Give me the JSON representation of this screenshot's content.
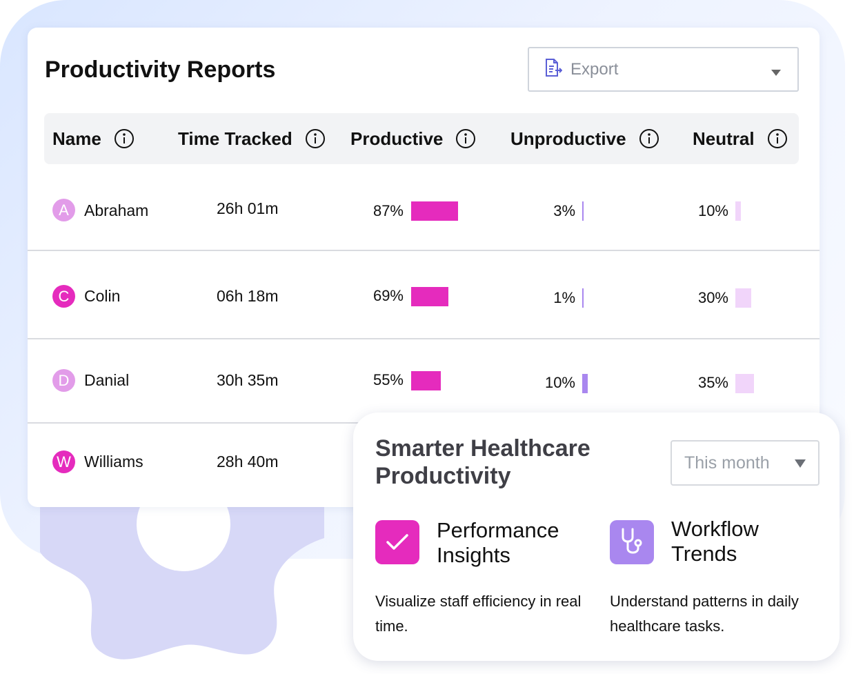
{
  "report": {
    "title": "Productivity Reports",
    "export_label": "Export",
    "columns": [
      {
        "label": "Name"
      },
      {
        "label": "Time Tracked"
      },
      {
        "label": "Productive"
      },
      {
        "label": "Unproductive"
      },
      {
        "label": "Neutral"
      }
    ],
    "rows": [
      {
        "initial": "A",
        "name": "Abraham",
        "time": "26h 01m",
        "productive": "87%",
        "productive_value": 0.87,
        "unproductive": "3%",
        "unproductive_value": 0.03,
        "neutral": "10%",
        "neutral_value": 0.1,
        "avatar_color": "#e29ce9"
      },
      {
        "initial": "C",
        "name": "Colin",
        "time": "06h 18m",
        "productive": "69%",
        "productive_value": 0.69,
        "unproductive": "1%",
        "unproductive_value": 0.01,
        "neutral": "30%",
        "neutral_value": 0.3,
        "avatar_color": "#e52bbd"
      },
      {
        "initial": "D",
        "name": "Danial",
        "time": "30h 35m",
        "productive": "55%",
        "productive_value": 0.55,
        "unproductive": "10%",
        "unproductive_value": 0.1,
        "neutral": "35%",
        "neutral_value": 0.35,
        "avatar_color": "#e29ce9"
      },
      {
        "initial": "W",
        "name": "Williams",
        "time": "28h 40m",
        "avatar_color": "#e52bbd"
      }
    ]
  },
  "overlay": {
    "title": "Smarter Healthcare Productivity",
    "period": "This month",
    "features": [
      {
        "title": "Performance Insights",
        "desc": "Visualize staff efficiency in real time.",
        "icon": "check-icon"
      },
      {
        "title": "Workflow Trends",
        "desc": "Understand patterns in daily healthcare tasks.",
        "icon": "stethoscope-icon"
      }
    ]
  },
  "colors": {
    "productive": "#e52bbd",
    "unproductive": "#a987ef",
    "neutral": "#f1d5fa",
    "feature_performance": "#e52bbd",
    "feature_workflow": "#a987ef"
  }
}
